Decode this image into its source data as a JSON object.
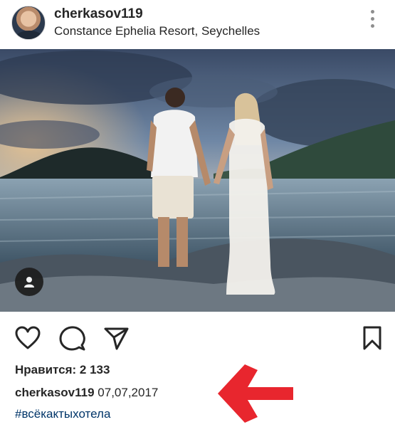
{
  "post": {
    "username": "cherkasov119",
    "location": "Constance Ephelia Resort, Seychelles"
  },
  "icons": {
    "more": "more-vertical-icon",
    "user_tag": "person-icon",
    "like": "heart-icon",
    "comment": "comment-icon",
    "share": "send-icon",
    "save": "bookmark-icon",
    "annotation": "arrow-left-icon"
  },
  "likes": {
    "label": "Нравится:",
    "count": "2 133"
  },
  "caption": {
    "username": "cherkasov119",
    "text": "07,07,2017"
  },
  "hashtag": "#всёкактыхотела",
  "colors": {
    "text": "#262626",
    "hashtag": "#003569",
    "annotation_arrow": "#e8262e"
  }
}
